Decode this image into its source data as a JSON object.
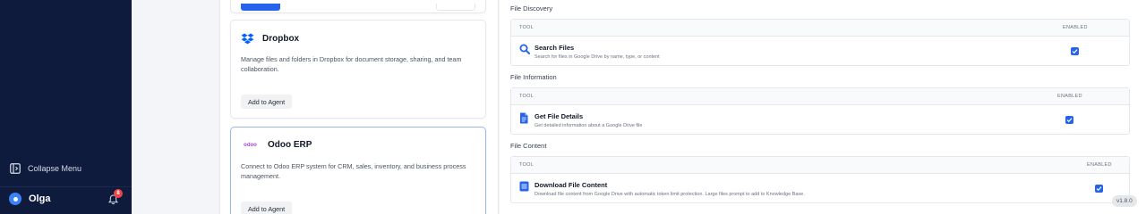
{
  "sidebar": {
    "collapse_label": "Collapse Menu",
    "user_name": "Olga",
    "notification_count": "8",
    "background_color": "#0f1b3d"
  },
  "integrations": {
    "dropbox": {
      "title": "Dropbox",
      "description": "Manage files and folders in Dropbox for document storage, sharing, and team collaboration.",
      "button": "Add to Agent",
      "icon": "dropbox-icon"
    },
    "odoo": {
      "title": "Odoo ERP",
      "logo_text": "odoo",
      "description": "Connect to Odoo ERP system for CRM, sales, inventory, and business process management.",
      "button": "Add to Agent"
    }
  },
  "tools": {
    "column_tool": "TOOL",
    "column_enabled": "ENABLED",
    "sections": [
      {
        "title": "File Discovery",
        "name": "Search Files",
        "description": "Search for files in Google Drive by name, type, or content",
        "enabled": true,
        "icon": "search-icon"
      },
      {
        "title": "File Information",
        "name": "Get File Details",
        "description": "Get detailed information about a Google Drive file",
        "enabled": true,
        "icon": "document-icon"
      },
      {
        "title": "File Content",
        "name": "Download File Content",
        "description": "Download file content from Google Drive with automatic token limit protection. Large files prompt to add to Knowledge Base.",
        "enabled": true,
        "icon": "download-file-icon"
      }
    ]
  },
  "version": "v1.8.0",
  "accent_color": "#2563eb"
}
